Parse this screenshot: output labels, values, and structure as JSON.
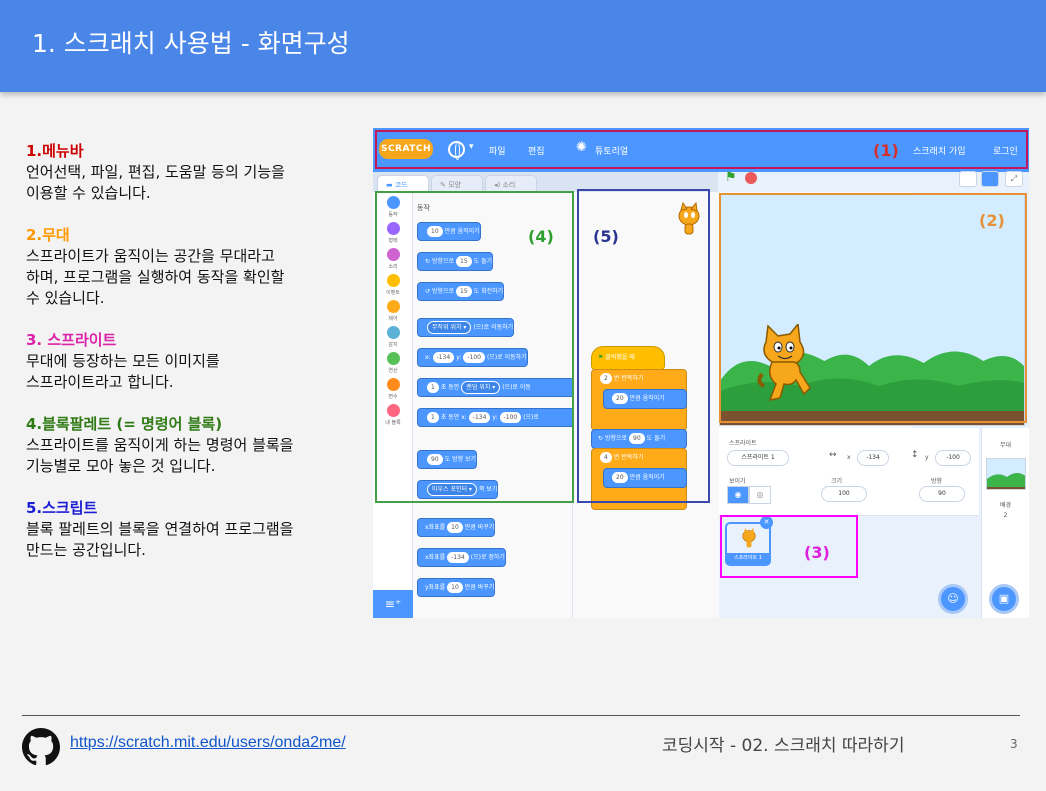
{
  "slide": {
    "title": "1. 스크래치 사용법 - 화면구성",
    "sections": [
      {
        "heading": "1.메뉴바",
        "lines": [
          "언어선택, 파일, 편집, 도움말 등의 기능을",
          "이용할 수 있습니다."
        ]
      },
      {
        "heading": "2.무대",
        "lines": [
          "스프라이트가 움직이는 공간을 무대라고",
          "하며, 프로그램을 실행하여 동작을 확인할",
          "수 있습니다."
        ]
      },
      {
        "heading": "3. 스프라이트",
        "lines": [
          "무대에 등장하는 모든 이미지를",
          "스프라이트라고 합니다."
        ]
      },
      {
        "heading": "4.블록팔레트 (= 명령어 블록)",
        "lines": [
          "스프라이트를 움직이게 하는 명령어 블록을",
          "기능별로 모아 놓은 것 입니다."
        ]
      },
      {
        "heading": "5.스크립트",
        "lines": [
          "블록 팔레트의 블록을 연결하여 프로그램을",
          "만드는 공간입니다."
        ]
      }
    ],
    "footer": {
      "link": "https://scratch.mit.edu/users/onda2me/",
      "text": "코딩시작 - 02. 스크래치 따라하기",
      "page": "3"
    }
  },
  "scratch": {
    "logo": "SCRATCH",
    "menu": {
      "file": "파일",
      "edit": "편집",
      "tutorial": "튜토리얼",
      "join": "스크래치 가입",
      "login": "로그인"
    },
    "tabs": {
      "code": "코드",
      "costume": "모양",
      "sound": "소리"
    },
    "categories": [
      {
        "label": "동작",
        "color": "#4c97ff"
      },
      {
        "label": "형태",
        "color": "#9966ff"
      },
      {
        "label": "소리",
        "color": "#cf63cf"
      },
      {
        "label": "이벤트",
        "color": "#ffbf00"
      },
      {
        "label": "제어",
        "color": "#ffab19"
      },
      {
        "label": "감지",
        "color": "#5cb1d6"
      },
      {
        "label": "연산",
        "color": "#59c059"
      },
      {
        "label": "변수",
        "color": "#ff8c1a"
      },
      {
        "label": "내 블록",
        "color": "#ff6680"
      }
    ],
    "palette_title": "동작",
    "palette_blocks": {
      "b1_num": "10",
      "b1_txt": "만큼 움직이기",
      "b2_pre": "방향으로",
      "b2_num": "15",
      "b2_txt": "도 돌기",
      "b3_pre": "방향으로",
      "b3_num": "15",
      "b3_txt": "도 회전하기",
      "b4_pre": "무작위 위치 ▾",
      "b4_txt": "(으)로 이동하기",
      "b5_x": "x:",
      "b5_xv": "-134",
      "b5_y": "y:",
      "b5_yv": "-100",
      "b5_txt": "(으)로 이동하기",
      "b6_num": "1",
      "b6_txt1": "초 동안",
      "b6_opt": "랜덤 위치 ▾",
      "b6_txt2": "(으)로 이동",
      "b7_num": "1",
      "b7_txt": "초 동안 x:",
      "b7_xv": "-134",
      "b7_y": "y:",
      "b7_yv": "-100",
      "b7_tail": "(으)로",
      "b8_num": "90",
      "b8_txt": "도 방향 보기",
      "b9_opt": "마우스 포인터 ▾",
      "b9_txt": "쪽 보기",
      "b10_pre": "x좌표를",
      "b10_num": "10",
      "b10_txt": "만큼 바꾸기",
      "b11_pre": "x좌표를",
      "b11_num": "-134",
      "b11_txt": "(으)로 정하기",
      "b12_pre": "y좌표를",
      "b12_num": "10",
      "b12_txt": "만큼 바꾸기"
    },
    "script_blocks": {
      "s1": "클릭했을 때",
      "s2_num": "2",
      "s2_txt": "번 반복하기",
      "s3_num": "20",
      "s3_txt": "만큼 움직이기",
      "s4_pre": "방향으로",
      "s4_num": "90",
      "s4_txt": "도 돌기",
      "s5_num": "4",
      "s5_txt": "번 반복하기",
      "s6_num": "20",
      "s6_txt": "만큼 움직이기"
    },
    "sprite_info": {
      "sprite_label": "스프라이트",
      "sprite_name": "스프라이트 1",
      "x_label": "x",
      "x_value": "-134",
      "y_label": "y",
      "y_value": "-100",
      "show_label": "보이기",
      "size_label": "크기",
      "size_value": "100",
      "direction_label": "방향",
      "direction_value": "90",
      "tile_name": "스프라이트 1"
    },
    "stage_pane": {
      "title": "무대",
      "backdrops_label": "배경",
      "backdrops_count": "2"
    }
  },
  "annotations": {
    "menubar": "(1)",
    "stage": "(2)",
    "sprite": "(3)",
    "palette": "(4)",
    "script": "(5)"
  },
  "colors": {
    "header": "#4a86e8",
    "scratch_blue": "#4c97ff",
    "box1": "#c2185b",
    "box2": "#e69138",
    "box3": "#ff00ff",
    "box4": "#43a047",
    "box5": "#3949ab"
  }
}
